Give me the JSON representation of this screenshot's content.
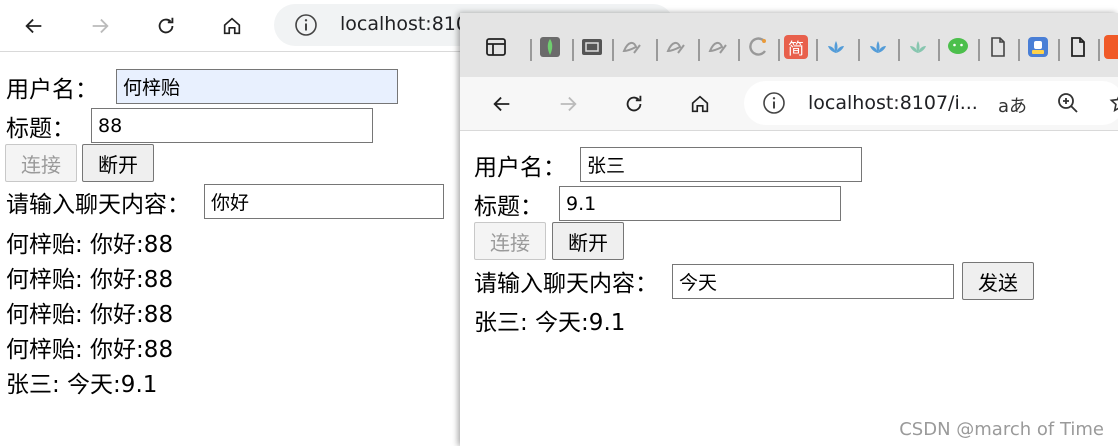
{
  "window1": {
    "address": "localhost:8107",
    "form": {
      "username_label": "用户名：",
      "username_value": "何梓贻",
      "title_label": "标题：",
      "title_value": "88",
      "connect_label": "连接",
      "disconnect_label": "断开",
      "chat_label": "请输入聊天内容：",
      "chat_value": "你好"
    },
    "messages": [
      "何梓贻: 你好:88",
      "何梓贻: 你好:88",
      "何梓贻: 你好:88",
      "何梓贻: 你好:88",
      "张三: 今天:9.1"
    ]
  },
  "window2": {
    "tab_icons": [
      "sidebar-icon",
      "mongodb-icon",
      "screenshot-icon",
      "tab-generic-icon",
      "tab-generic-icon",
      "tab-generic-icon",
      "tab-c-icon",
      "jian-icon",
      "lotus-icon",
      "lotus-icon",
      "lotus-icon",
      "wechat-icon",
      "page-icon",
      "app-icon",
      "page-icon",
      "orange-app-icon"
    ],
    "jian_char": "简",
    "address": "localhost:8107/i...",
    "read_aloud": "aあ",
    "form": {
      "username_label": "用户名：",
      "username_value": "张三",
      "title_label": "标题：",
      "title_value": "9.1",
      "connect_label": "连接",
      "disconnect_label": "断开",
      "chat_label": "请输入聊天内容：",
      "chat_value": "今天",
      "send_label": "发送"
    },
    "messages": [
      "张三: 今天:9.1"
    ]
  },
  "watermark": "CSDN @march of Time",
  "colors": {
    "autofill": "#e8f0fe",
    "tabstrip": "#e4e4e4",
    "jian": "#e8604c",
    "lotus": "#3a8fd6",
    "wechat": "#4cbf4c",
    "app": "#4a7fd6",
    "orange": "#f05a28"
  }
}
